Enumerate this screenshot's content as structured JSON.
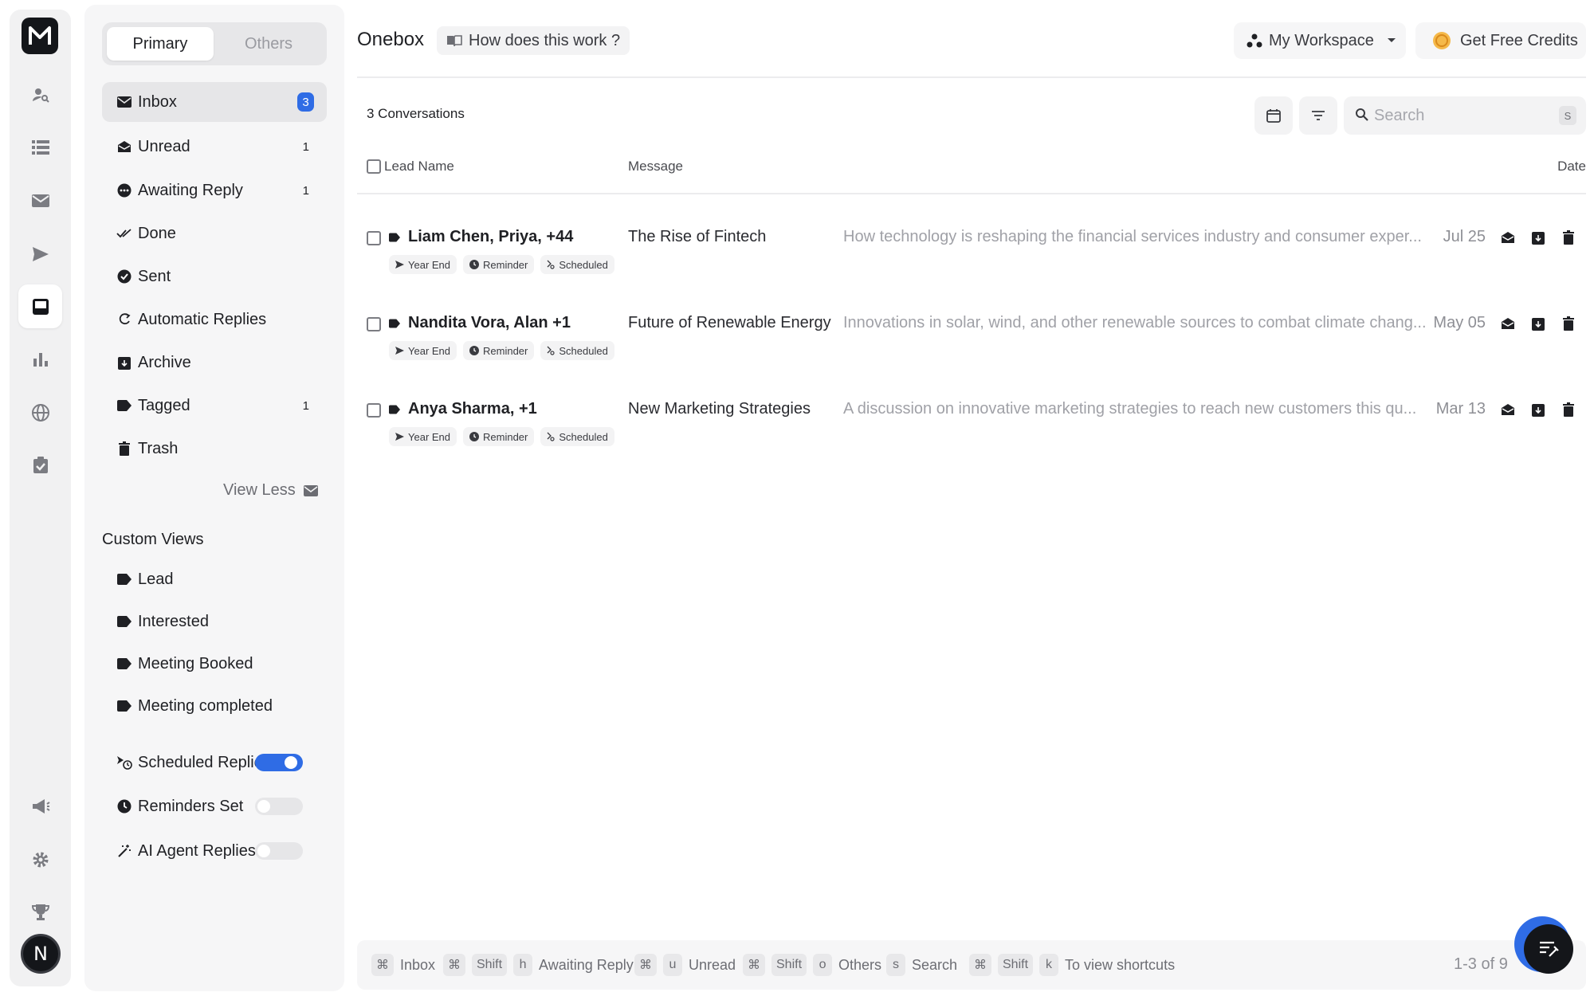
{
  "app": {
    "logo_letter": "M",
    "avatar_letter": "N"
  },
  "tabs": {
    "primary": "Primary",
    "others": "Others"
  },
  "folders": [
    {
      "label": "Inbox",
      "count": "3"
    },
    {
      "label": "Unread",
      "count": "1"
    },
    {
      "label": "Awaiting Reply",
      "count": "1"
    },
    {
      "label": "Done",
      "count": ""
    },
    {
      "label": "Sent",
      "count": ""
    },
    {
      "label": "Automatic Replies",
      "count": ""
    },
    {
      "label": "Archive",
      "count": ""
    },
    {
      "label": "Tagged",
      "count": "1"
    },
    {
      "label": "Trash",
      "count": ""
    }
  ],
  "view_less": "View Less",
  "custom_views": {
    "title": "Custom Views",
    "items": [
      "Lead",
      "Interested",
      "Meeting Booked",
      "Meeting completed"
    ]
  },
  "toggles": [
    {
      "label": "Scheduled Replies",
      "on": true
    },
    {
      "label": "Reminders Set",
      "on": false
    },
    {
      "label": "AI Agent Replies",
      "on": false
    }
  ],
  "header": {
    "title": "Onebox",
    "how_link": "How does this work ?",
    "workspace": "My Workspace",
    "credits": "Get Free Credits"
  },
  "list": {
    "count_label": "3 Conversations",
    "search_placeholder": "Search",
    "search_shortcut": "S",
    "columns": {
      "lead": "Lead Name",
      "message": "Message",
      "date": "Date"
    },
    "chips": {
      "yearend": "Year End",
      "reminder": "Reminder",
      "scheduled": "Scheduled"
    },
    "rows": [
      {
        "lead": "Liam Chen, Priya, +44",
        "subject": "The Rise of Fintech",
        "preview": "How technology is reshaping the financial services industry and consumer exper...",
        "date": "Jul 25"
      },
      {
        "lead": "Nandita Vora, Alan +1",
        "subject": "Future of Renewable Energy",
        "preview": "Innovations in solar, wind, and other renewable sources to combat climate chang...",
        "date": "May 05"
      },
      {
        "lead": "Anya Sharma, +1",
        "subject": "New Marketing Strategies",
        "preview": "A discussion on innovative marketing strategies to reach new customers this qu...",
        "date": "Mar 13"
      }
    ]
  },
  "footer": {
    "shortcuts": {
      "cmd": "⌘",
      "shift": "Shift",
      "inbox": "Inbox",
      "h": "h",
      "awaiting": "Awaiting Reply",
      "u": "u",
      "unread": "Unread",
      "o": "o",
      "others": "Others",
      "s": "s",
      "search": "Search",
      "k": "k",
      "view": "To view shortcuts"
    },
    "pager": "1-3 of 9"
  },
  "colors": {
    "accent": "#2f6ce5",
    "dark": "#14161a"
  }
}
